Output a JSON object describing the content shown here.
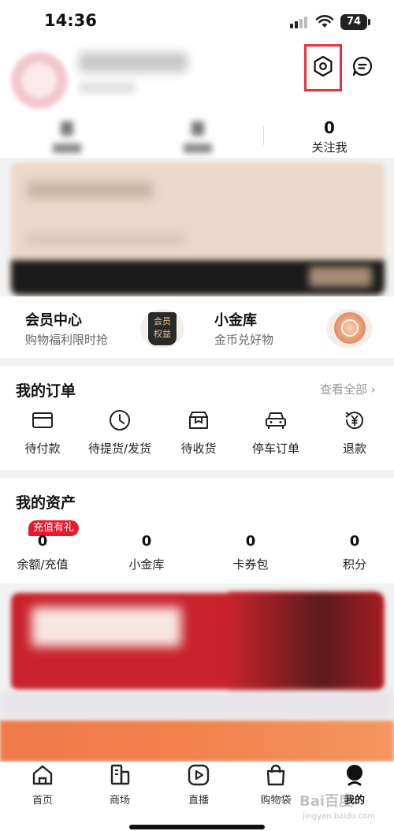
{
  "status_bar": {
    "time": "14:36",
    "battery": "74"
  },
  "profile": {
    "stats": [
      {
        "value": "0",
        "label": "关注我"
      }
    ]
  },
  "membership": {
    "member_center_title": "会员中心",
    "member_center_sub": "购物福利限时抢",
    "badge_text_1": "会员",
    "badge_text_2": "权益",
    "gold_title": "小金库",
    "gold_sub": "金币兑好物"
  },
  "orders": {
    "title": "我的订单",
    "view_all": "查看全部 ›",
    "items": [
      {
        "label": "待付款",
        "icon": "wallet-card-icon"
      },
      {
        "label": "待提货/发货",
        "icon": "clock-icon"
      },
      {
        "label": "待收货",
        "icon": "package-box-icon"
      },
      {
        "label": "停车订单",
        "icon": "car-icon"
      },
      {
        "label": "退款",
        "icon": "refund-yen-icon"
      }
    ]
  },
  "assets": {
    "title": "我的资产",
    "recharge_tag": "充值有礼",
    "items": [
      {
        "value": "0",
        "label": "余额/充值"
      },
      {
        "value": "0",
        "label": "小金库"
      },
      {
        "value": "0",
        "label": "卡券包"
      },
      {
        "value": "0",
        "label": "积分"
      }
    ]
  },
  "tab_bar": {
    "items": [
      {
        "label": "首页",
        "icon": "home-icon"
      },
      {
        "label": "商场",
        "icon": "mall-building-icon"
      },
      {
        "label": "直播",
        "icon": "live-play-icon"
      },
      {
        "label": "购物袋",
        "icon": "shopping-bag-icon"
      },
      {
        "label": "我的",
        "icon": "profile-icon"
      }
    ],
    "active_index": 4
  },
  "watermark": {
    "brand": "Bai百度",
    "sub": "jingyan.baidu.com"
  },
  "colors": {
    "highlight": "#e8313a",
    "tag_red": "#e8192c",
    "banner_red": "#c8232c",
    "banner_orange": "#f2824e"
  }
}
